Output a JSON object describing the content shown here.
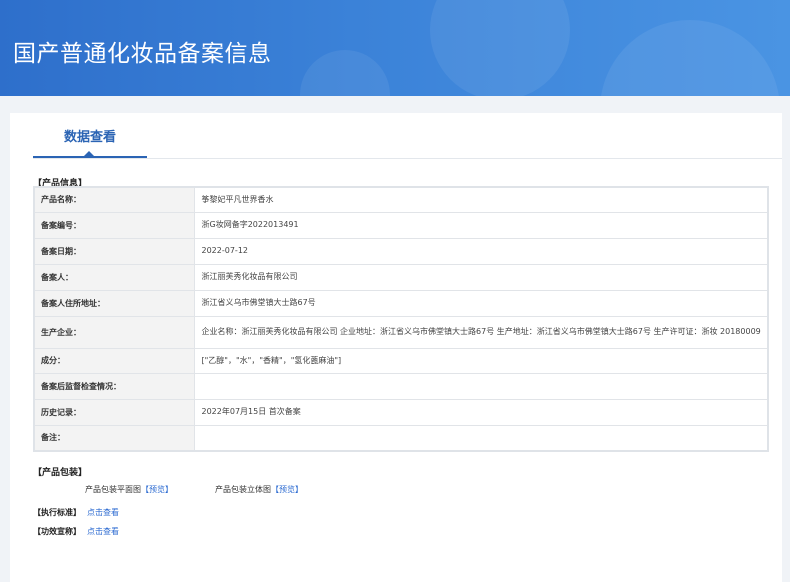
{
  "header": {
    "title": "国产普通化妆品备案信息"
  },
  "tabs": [
    {
      "label": "数据查看"
    }
  ],
  "product_info": {
    "section_title": "【产品信息】",
    "rows": [
      {
        "key": "产品名称：",
        "value": "筝黎妃平凡世界香水"
      },
      {
        "key": "备案编号：",
        "value": "浙G妆网备字2022013491"
      },
      {
        "key": "备案日期：",
        "value": "2022-07-12"
      },
      {
        "key": "备案人：",
        "value": "浙江丽芙秀化妆品有限公司"
      },
      {
        "key": "备案人住所地址：",
        "value": "浙江省义乌市佛堂镇大士路67号"
      },
      {
        "key": "生产企业：",
        "value": "企业名称：浙江丽芙秀化妆品有限公司 企业地址：浙江省义乌市佛堂镇大士路67号 生产地址：浙江省义乌市佛堂镇大士路67号 生产许可证：浙妆 20180009"
      },
      {
        "key": "成分：",
        "value": "[\"乙醇\"，\"水\"，\"香精\"，\"氢化蓖麻油\"]"
      },
      {
        "key": "备案后监督检查情况：",
        "value": ""
      },
      {
        "key": "历史记录：",
        "value": "2022年07月15日 首次备案"
      },
      {
        "key": "备注：",
        "value": ""
      }
    ]
  },
  "packaging": {
    "section_title": "【产品包装】",
    "items": [
      {
        "label": "产品包装平面图",
        "link": "【预览】"
      },
      {
        "label": "产品包装立体图",
        "link": "【预览】"
      }
    ]
  },
  "standard": {
    "label": "【执行标准】",
    "link": "点击查看"
  },
  "efficacy": {
    "label": "【功效宣称】",
    "link": "点击查看"
  },
  "colors": {
    "header_start": "#2e6fcb",
    "header_end": "#4a94e3",
    "accent": "#2b64b4",
    "link": "#2b6ad1"
  }
}
